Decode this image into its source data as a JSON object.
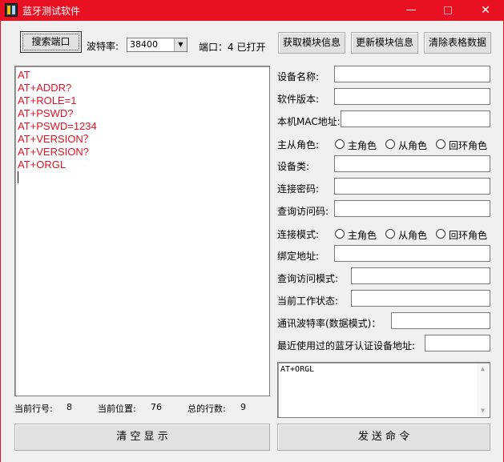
{
  "window": {
    "title": "蓝牙测试软件",
    "minimize_glyph": "—",
    "close_glyph": "✕",
    "accent_color": "#e81123"
  },
  "toolbar": {
    "search_port_label": "搜索端口",
    "baud_label": "波特率:",
    "baud_value": "38400",
    "port_status": "端口：4  已打开",
    "get_info_label": "获取模块信息",
    "update_info_label": "更新模块信息",
    "clear_table_label": "清除表格数据"
  },
  "log": {
    "lines": [
      "AT",
      "AT+ADDR?",
      "AT+ROLE=1",
      "AT+PSWD?",
      "AT+PSWD=1234",
      "AT+VERSION？",
      "AT+VERSION?",
      "AT+ORGL"
    ],
    "text_color": "#e81123"
  },
  "fields": {
    "device_name": "设备名称:",
    "software_version": "软件版本:",
    "mac_address": "本机MAC地址:",
    "role": "主从角色:",
    "device_class": "设备类:",
    "pair_password": "连接密码:",
    "inquiry_access_code": "查询访问码:",
    "connect_mode": "连接模式:",
    "bind_address": "绑定地址:",
    "inquiry_access_mode": "查询访问模式:",
    "work_state": "当前工作状态:",
    "comm_baud": "通讯波特率(数据模式)：",
    "recent_device": "最近使用过的蓝牙认证设备地址:"
  },
  "radios": {
    "master": "主角色",
    "slave": "从角色",
    "loopback": "回环角色"
  },
  "command": {
    "text": "AT+ORGL"
  },
  "status": {
    "row_label": "当前行号:",
    "row_value": "8",
    "pos_label": "当前位置:",
    "pos_value": "76",
    "total_label": "总的行数:",
    "total_value": "9"
  },
  "buttons": {
    "clear_display": "清 空 显 示",
    "send_command": "发 送 命 令"
  }
}
